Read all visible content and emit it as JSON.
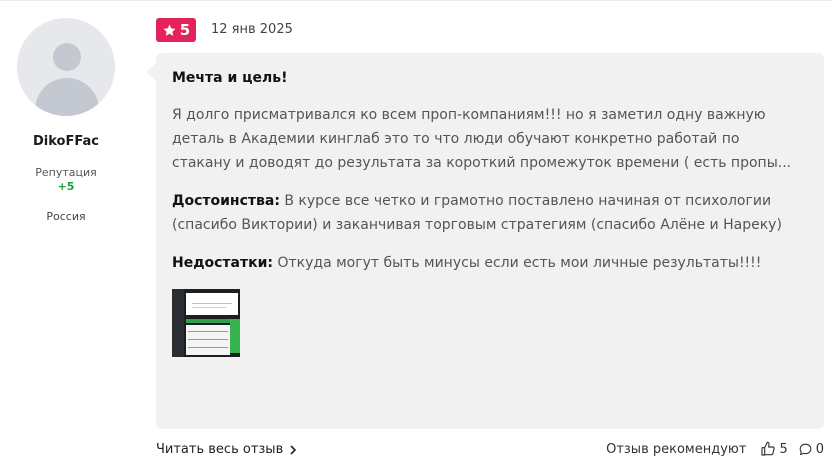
{
  "author": {
    "username": "DikoFFac",
    "reputation_label": "Репутация",
    "reputation_value": "+5",
    "country": "Россия"
  },
  "review": {
    "rating": "5",
    "date": "12 янв 2025",
    "title": "Мечта и цель!",
    "text": "Я долго присматривался ко всем проп-компаниям!!! но я заметил одну важную деталь в Академии кинглаб это то что люди обучают конкретно работай по стакану и доводят до результата за короткий промежуток времени ( есть пропы...",
    "pros_label": "Достоинства:",
    "pros_text": "В курсе все четко и грамотно поставлено начиная от психологии (спасибо Виктории) и заканчивая торговым стратегиям (спасибо Алёне и Нареку)",
    "cons_label": "Недостатки:",
    "cons_text": "Откуда могут быть минусы если есть мои личные результаты!!!!"
  },
  "footer": {
    "read_more": "Читать весь отзыв",
    "recommend_label": "Отзыв рекомендуют",
    "likes_count": "5",
    "comments_count": "0"
  },
  "icons": {
    "rating": "star-icon",
    "read_more": "chevron-right-icon",
    "like": "thumbs-up-icon",
    "comment": "comment-icon"
  },
  "colors": {
    "rating_badge": "#e2245b",
    "reputation_positive": "#1e9e3e",
    "card_background": "#f1f1f1"
  }
}
